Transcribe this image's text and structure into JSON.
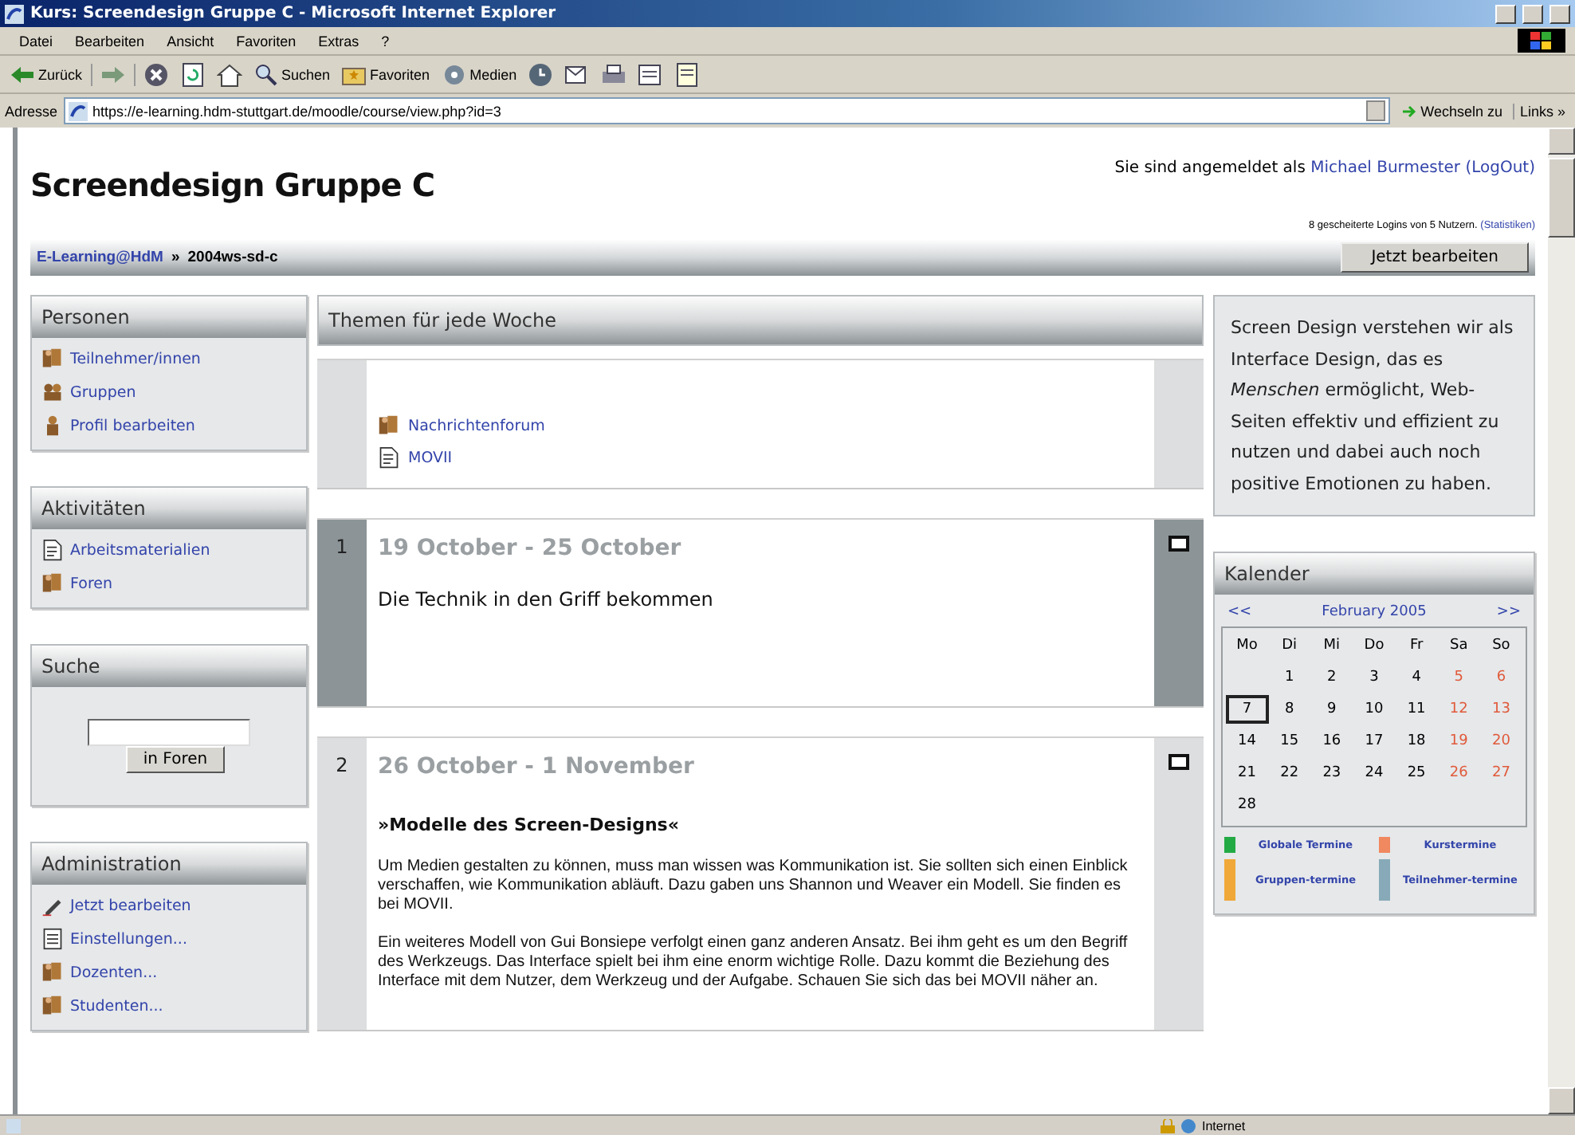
{
  "window": {
    "title": "Kurs: Screendesign Gruppe C - Microsoft Internet Explorer"
  },
  "menu": [
    "Datei",
    "Bearbeiten",
    "Ansicht",
    "Favoriten",
    "Extras",
    "?"
  ],
  "toolbar": [
    {
      "kind": "back",
      "label": "Zurück"
    },
    {
      "kind": "forward"
    },
    {
      "kind": "stop"
    },
    {
      "kind": "refresh"
    },
    {
      "kind": "home"
    },
    {
      "kind": "search",
      "label": "Suchen"
    },
    {
      "kind": "favorites",
      "label": "Favoriten"
    },
    {
      "kind": "media",
      "label": "Medien"
    },
    {
      "kind": "history"
    },
    {
      "kind": "mail"
    },
    {
      "kind": "print"
    },
    {
      "kind": "edit"
    },
    {
      "kind": "discuss"
    }
  ],
  "address_bar": {
    "label": "Adresse",
    "url": "https://e-learning.hdm-stuttgart.de/moodle/course/view.php?id=3",
    "go": "Wechseln zu",
    "links": "Links »"
  },
  "page": {
    "title": "Screendesign Gruppe C",
    "login_prefix": "Sie sind angemeldet als",
    "user": "Michael Burmester",
    "logout": "(LogOut)",
    "failed_logins": "8 gescheiterte Logins von 5 Nutzern.",
    "failed_link": "(Statistiken)"
  },
  "breadcrumb": {
    "items": [
      {
        "label": "E-Learning@HdM",
        "link": true
      },
      {
        "label": "»",
        "link": false
      },
      {
        "label": "2004ws-sd-c",
        "link": false
      }
    ],
    "button": "Jetzt bearbeiten"
  },
  "left_blocks": [
    {
      "title": "Personen",
      "kind": "links",
      "items": [
        {
          "label": "Teilnehmer/innen",
          "kind": "people"
        },
        {
          "label": "Gruppen",
          "kind": "group"
        },
        {
          "label": "Profil bearbeiten",
          "kind": "person"
        }
      ]
    },
    {
      "title": "Aktivitäten",
      "kind": "links",
      "items": [
        {
          "label": "Arbeitsmaterialien",
          "kind": "document"
        },
        {
          "label": "Foren",
          "kind": "people"
        }
      ]
    },
    {
      "title": "Suche",
      "kind": "search",
      "button": "in Foren"
    },
    {
      "title": "Administration",
      "kind": "links",
      "items": [
        {
          "label": "Jetzt bearbeiten",
          "kind": "pencil"
        },
        {
          "label": "Einstellungen...",
          "kind": "settings"
        },
        {
          "label": "Dozenten...",
          "kind": "people"
        },
        {
          "label": "Studenten...",
          "kind": "people"
        }
      ]
    }
  ],
  "center": {
    "title": "Themen für jede Woche",
    "sections": [
      {
        "current": false,
        "items": [
          {
            "label": "Nachrichtenforum",
            "kind": "people"
          },
          {
            "label": "MOVII",
            "kind": "document"
          }
        ]
      },
      {
        "number": "1",
        "title": "19 October - 25 October",
        "current": true,
        "paragraphs": [
          {
            "kind": "summary",
            "text": "Die Technik in den Griff bekommen"
          }
        ]
      },
      {
        "number": "2",
        "title": "26 October - 1 November",
        "current": false,
        "paragraphs": [
          {
            "kind": "heading",
            "text": "»Modelle des Screen-Designs«"
          },
          {
            "kind": "body",
            "text": "Um Medien gestalten zu können, muss man wissen was Kommunikation ist. Sie sollten sich einen Einblick verschaffen, wie Kommunikation abläuft. Dazu gaben uns Shannon und Weaver ein Modell. Sie finden es bei MOVII."
          },
          {
            "kind": "body",
            "text": "Ein weiteres Modell von Gui Bonsiepe verfolgt einen ganz anderen Ansatz. Bei ihm geht es um den Begriff des Werkzeugs. Das Interface spielt bei ihm eine enorm wichtige Rolle. Dazu kommt die Beziehung des Interface mit dem Nutzer, dem Werkzeug und der Aufgabe. Schauen Sie sich das bei MOVII näher an."
          }
        ]
      }
    ]
  },
  "summary": "Screen Design verstehen wir als Interface Design, das es *Menschen* ermöglicht, Web-Seiten effektiv und effizient zu nutzen und dabei auch noch positive Emotionen zu haben.",
  "calendar": {
    "title": "Kalender",
    "prev": "<<",
    "month": "February 2005",
    "next": ">>",
    "weekdays": [
      "Mo",
      "Di",
      "Mi",
      "Do",
      "Fr",
      "Sa",
      "So"
    ],
    "weeks": [
      [
        {
          "day": "1",
          "weekend": false,
          "today": false
        },
        {
          "day": "2",
          "weekend": false,
          "today": false
        },
        {
          "day": "3",
          "weekend": false,
          "today": false
        },
        {
          "day": "4",
          "weekend": false,
          "today": false
        },
        {
          "day": "5",
          "weekend": true,
          "today": false
        },
        {
          "day": "6",
          "weekend": true,
          "today": false
        }
      ],
      [
        {
          "day": "7",
          "weekend": false,
          "today": true
        },
        {
          "day": "8",
          "weekend": false,
          "today": false
        },
        {
          "day": "9",
          "weekend": false,
          "today": false
        },
        {
          "day": "10",
          "weekend": false,
          "today": false
        },
        {
          "day": "11",
          "weekend": false,
          "today": false
        },
        {
          "day": "12",
          "weekend": true,
          "today": false
        },
        {
          "day": "13",
          "weekend": true,
          "today": false
        }
      ],
      [
        {
          "day": "14",
          "weekend": false,
          "today": false
        },
        {
          "day": "15",
          "weekend": false,
          "today": false
        },
        {
          "day": "16",
          "weekend": false,
          "today": false
        },
        {
          "day": "17",
          "weekend": false,
          "today": false
        },
        {
          "day": "18",
          "weekend": false,
          "today": false
        },
        {
          "day": "19",
          "weekend": true,
          "today": false
        },
        {
          "day": "20",
          "weekend": true,
          "today": false
        }
      ],
      [
        {
          "day": "21",
          "weekend": false,
          "today": false
        },
        {
          "day": "22",
          "weekend": false,
          "today": false
        },
        {
          "day": "23",
          "weekend": false,
          "today": false
        },
        {
          "day": "24",
          "weekend": false,
          "today": false
        },
        {
          "day": "25",
          "weekend": false,
          "today": false
        },
        {
          "day": "26",
          "weekend": true,
          "today": false
        },
        {
          "day": "27",
          "weekend": true,
          "today": false
        }
      ],
      [
        {
          "day": "28",
          "weekend": false,
          "today": false
        }
      ]
    ],
    "legend": [
      {
        "label": "Globale Termine",
        "color": "#22aa44"
      },
      {
        "label": "Kurstermine",
        "color": "#f08860"
      },
      {
        "label": "Gruppen-termine",
        "color": "#f0a838"
      },
      {
        "label": "Teilnehmer-termine",
        "color": "#88aab8"
      }
    ]
  },
  "status_bar": {
    "zone": "Internet"
  }
}
